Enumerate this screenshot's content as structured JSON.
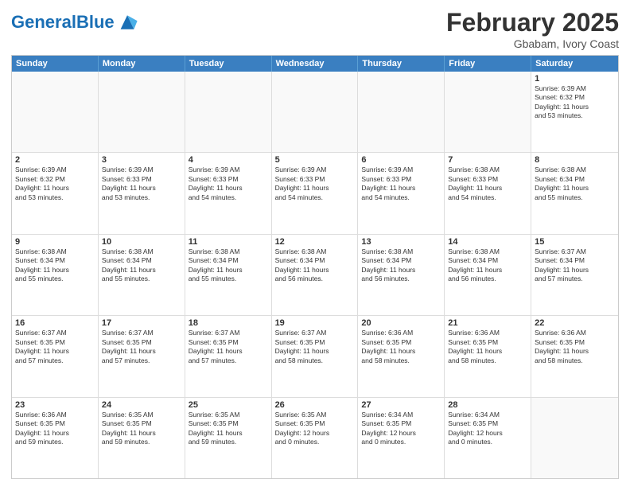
{
  "header": {
    "logo_general": "General",
    "logo_blue": "Blue",
    "main_title": "February 2025",
    "subtitle": "Gbabam, Ivory Coast"
  },
  "calendar": {
    "days_of_week": [
      "Sunday",
      "Monday",
      "Tuesday",
      "Wednesday",
      "Thursday",
      "Friday",
      "Saturday"
    ],
    "rows": [
      [
        {
          "day": "",
          "info": ""
        },
        {
          "day": "",
          "info": ""
        },
        {
          "day": "",
          "info": ""
        },
        {
          "day": "",
          "info": ""
        },
        {
          "day": "",
          "info": ""
        },
        {
          "day": "",
          "info": ""
        },
        {
          "day": "1",
          "info": "Sunrise: 6:39 AM\nSunset: 6:32 PM\nDaylight: 11 hours\nand 53 minutes."
        }
      ],
      [
        {
          "day": "2",
          "info": "Sunrise: 6:39 AM\nSunset: 6:32 PM\nDaylight: 11 hours\nand 53 minutes."
        },
        {
          "day": "3",
          "info": "Sunrise: 6:39 AM\nSunset: 6:33 PM\nDaylight: 11 hours\nand 53 minutes."
        },
        {
          "day": "4",
          "info": "Sunrise: 6:39 AM\nSunset: 6:33 PM\nDaylight: 11 hours\nand 54 minutes."
        },
        {
          "day": "5",
          "info": "Sunrise: 6:39 AM\nSunset: 6:33 PM\nDaylight: 11 hours\nand 54 minutes."
        },
        {
          "day": "6",
          "info": "Sunrise: 6:39 AM\nSunset: 6:33 PM\nDaylight: 11 hours\nand 54 minutes."
        },
        {
          "day": "7",
          "info": "Sunrise: 6:38 AM\nSunset: 6:33 PM\nDaylight: 11 hours\nand 54 minutes."
        },
        {
          "day": "8",
          "info": "Sunrise: 6:38 AM\nSunset: 6:34 PM\nDaylight: 11 hours\nand 55 minutes."
        }
      ],
      [
        {
          "day": "9",
          "info": "Sunrise: 6:38 AM\nSunset: 6:34 PM\nDaylight: 11 hours\nand 55 minutes."
        },
        {
          "day": "10",
          "info": "Sunrise: 6:38 AM\nSunset: 6:34 PM\nDaylight: 11 hours\nand 55 minutes."
        },
        {
          "day": "11",
          "info": "Sunrise: 6:38 AM\nSunset: 6:34 PM\nDaylight: 11 hours\nand 55 minutes."
        },
        {
          "day": "12",
          "info": "Sunrise: 6:38 AM\nSunset: 6:34 PM\nDaylight: 11 hours\nand 56 minutes."
        },
        {
          "day": "13",
          "info": "Sunrise: 6:38 AM\nSunset: 6:34 PM\nDaylight: 11 hours\nand 56 minutes."
        },
        {
          "day": "14",
          "info": "Sunrise: 6:38 AM\nSunset: 6:34 PM\nDaylight: 11 hours\nand 56 minutes."
        },
        {
          "day": "15",
          "info": "Sunrise: 6:37 AM\nSunset: 6:34 PM\nDaylight: 11 hours\nand 57 minutes."
        }
      ],
      [
        {
          "day": "16",
          "info": "Sunrise: 6:37 AM\nSunset: 6:35 PM\nDaylight: 11 hours\nand 57 minutes."
        },
        {
          "day": "17",
          "info": "Sunrise: 6:37 AM\nSunset: 6:35 PM\nDaylight: 11 hours\nand 57 minutes."
        },
        {
          "day": "18",
          "info": "Sunrise: 6:37 AM\nSunset: 6:35 PM\nDaylight: 11 hours\nand 57 minutes."
        },
        {
          "day": "19",
          "info": "Sunrise: 6:37 AM\nSunset: 6:35 PM\nDaylight: 11 hours\nand 58 minutes."
        },
        {
          "day": "20",
          "info": "Sunrise: 6:36 AM\nSunset: 6:35 PM\nDaylight: 11 hours\nand 58 minutes."
        },
        {
          "day": "21",
          "info": "Sunrise: 6:36 AM\nSunset: 6:35 PM\nDaylight: 11 hours\nand 58 minutes."
        },
        {
          "day": "22",
          "info": "Sunrise: 6:36 AM\nSunset: 6:35 PM\nDaylight: 11 hours\nand 58 minutes."
        }
      ],
      [
        {
          "day": "23",
          "info": "Sunrise: 6:36 AM\nSunset: 6:35 PM\nDaylight: 11 hours\nand 59 minutes."
        },
        {
          "day": "24",
          "info": "Sunrise: 6:35 AM\nSunset: 6:35 PM\nDaylight: 11 hours\nand 59 minutes."
        },
        {
          "day": "25",
          "info": "Sunrise: 6:35 AM\nSunset: 6:35 PM\nDaylight: 11 hours\nand 59 minutes."
        },
        {
          "day": "26",
          "info": "Sunrise: 6:35 AM\nSunset: 6:35 PM\nDaylight: 12 hours\nand 0 minutes."
        },
        {
          "day": "27",
          "info": "Sunrise: 6:34 AM\nSunset: 6:35 PM\nDaylight: 12 hours\nand 0 minutes."
        },
        {
          "day": "28",
          "info": "Sunrise: 6:34 AM\nSunset: 6:35 PM\nDaylight: 12 hours\nand 0 minutes."
        },
        {
          "day": "",
          "info": ""
        }
      ]
    ]
  }
}
